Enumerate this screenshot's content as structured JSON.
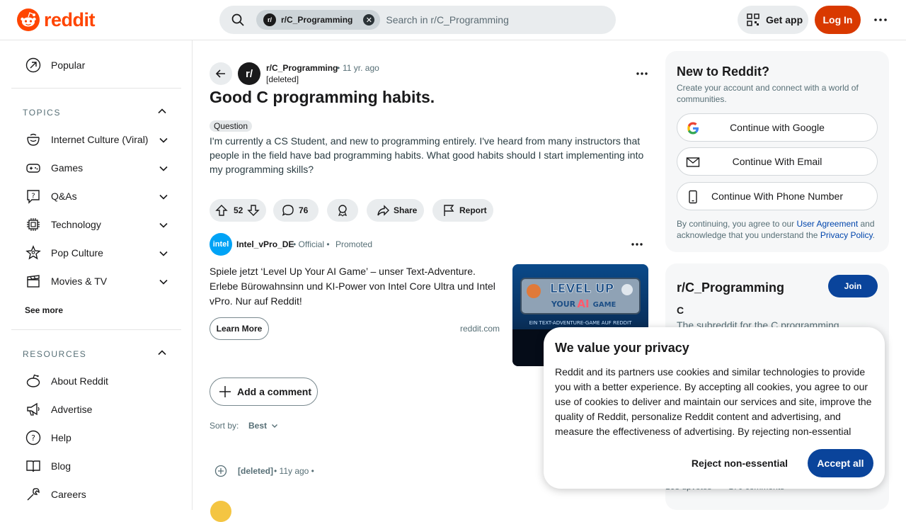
{
  "header": {
    "logo_text": "reddit",
    "search_chip": "r/C_Programming",
    "search_placeholder": "Search in r/C_Programming",
    "get_app": "Get app",
    "login": "Log In"
  },
  "sidebar": {
    "popular": "Popular",
    "topics_header": "TOPICS",
    "topics": [
      {
        "label": "Internet Culture (Viral)",
        "icon": "smile-icon"
      },
      {
        "label": "Games",
        "icon": "gamepad-icon"
      },
      {
        "label": "Q&As",
        "icon": "question-icon"
      },
      {
        "label": "Technology",
        "icon": "chip-icon"
      },
      {
        "label": "Pop Culture",
        "icon": "star-person-icon"
      },
      {
        "label": "Movies & TV",
        "icon": "clapper-icon"
      }
    ],
    "see_more": "See more",
    "resources_header": "RESOURCES",
    "resources": [
      {
        "label": "About Reddit",
        "icon": "alien-icon"
      },
      {
        "label": "Advertise",
        "icon": "megaphone-icon"
      },
      {
        "label": "Help",
        "icon": "help-icon"
      },
      {
        "label": "Blog",
        "icon": "book-icon"
      },
      {
        "label": "Careers",
        "icon": "wrench-icon"
      }
    ]
  },
  "post": {
    "subreddit": "r/C_Programming",
    "sub_avatar": "r/",
    "sep": "•",
    "age": "11 yr. ago",
    "author": "[deleted]",
    "title": "Good C programming habits.",
    "flair": "Question",
    "body": "I'm currently a CS Student, and new to programming entirely. I've heard from many instructors that people in the field have bad programming habits. What good habits should I start implementing into my programming skills?",
    "votes": "52",
    "comments": "76",
    "share": "Share",
    "report": "Report"
  },
  "ad": {
    "logo": "intel",
    "advertiser": "Intel_vPro_DE",
    "official": "• Official  •",
    "promoted": "Promoted",
    "text": "Spiele jetzt ‘Level Up Your AI Game’ – unser Text-Adventure. Erlebe Bürowahnsinn und KI-Power von Intel Core Ultra und Intel vPro. Nur auf Reddit!",
    "cta": "Learn More",
    "domain": "reddit.com",
    "image_line1": "LEVEL UP",
    "image_line2_a": "YOUR",
    "image_line2_b": "AI",
    "image_line2_c": "GAME",
    "image_caption": "EIN TEXT-ADVENTURE-GAME AUF REDDIT"
  },
  "comments": {
    "add": "Add a comment",
    "sort_label": "Sort by:",
    "sort_value": "Best",
    "first_author": "[deleted]",
    "first_meta": "• 11y ago •"
  },
  "newbox": {
    "title": "New to Reddit?",
    "subtitle": "Create your account and connect with a world of communities.",
    "google": "Continue with Google",
    "email": "Continue With Email",
    "phone": "Continue With Phone Number",
    "terms_pre": "By continuing, you agree to our ",
    "terms_link": "User Agreement",
    "terms_mid": " and acknowledge that you understand the ",
    "privacy_link": "Privacy Policy",
    "terms_end": "."
  },
  "community": {
    "name": "r/C_Programming",
    "join": "Join",
    "tag": "C",
    "desc": "The subreddit for the C programming",
    "upvotes": "168 upvotes",
    "comments": "170 comments"
  },
  "consent": {
    "title": "We value your privacy",
    "text": "Reddit and its partners use cookies and similar technologies to provide you with a better experience. By accepting all cookies, you agree to our use of cookies to deliver and maintain our services and site, improve the quality of Reddit, personalize Reddit content and advertising, and measure the effectiveness of advertising. By rejecting non-essential cookies, Reddit may still use certain cookies to ensure the proper functionality of our platform.",
    "reject": "Reject non-essential",
    "accept": "Accept all"
  },
  "colors": {
    "brand": "#ff4500",
    "login": "#d93900",
    "join": "#0a449b",
    "link": "#0045ac"
  }
}
